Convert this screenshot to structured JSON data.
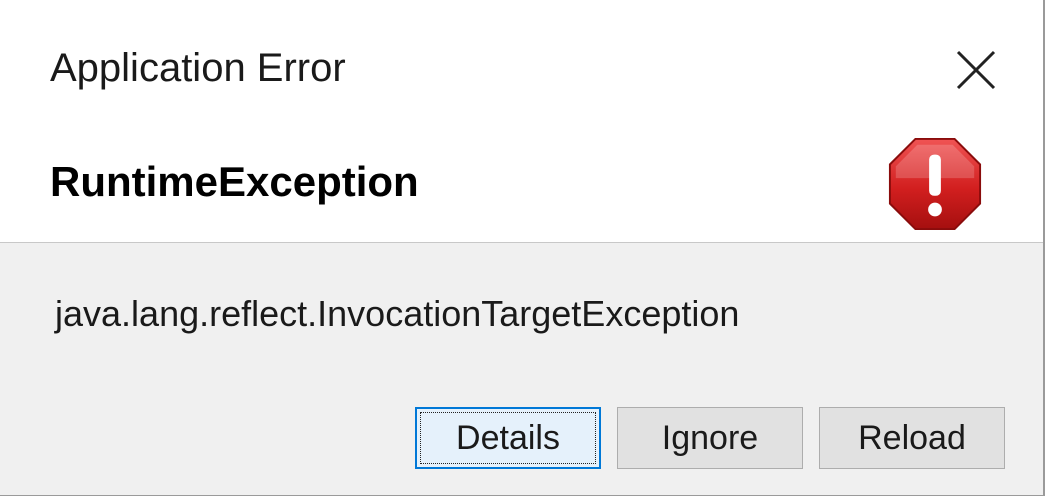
{
  "window": {
    "title": "Application Error"
  },
  "header": {
    "title": "RuntimeException",
    "icon": "error-stop-icon"
  },
  "body": {
    "message": "java.lang.reflect.InvocationTargetException"
  },
  "buttons": {
    "details": "Details",
    "ignore": "Ignore",
    "reload": "Reload"
  },
  "colors": {
    "content_background": "#f0f0f0",
    "default_button_border": "#0078d7",
    "error_icon_red": "#d21f1f"
  }
}
